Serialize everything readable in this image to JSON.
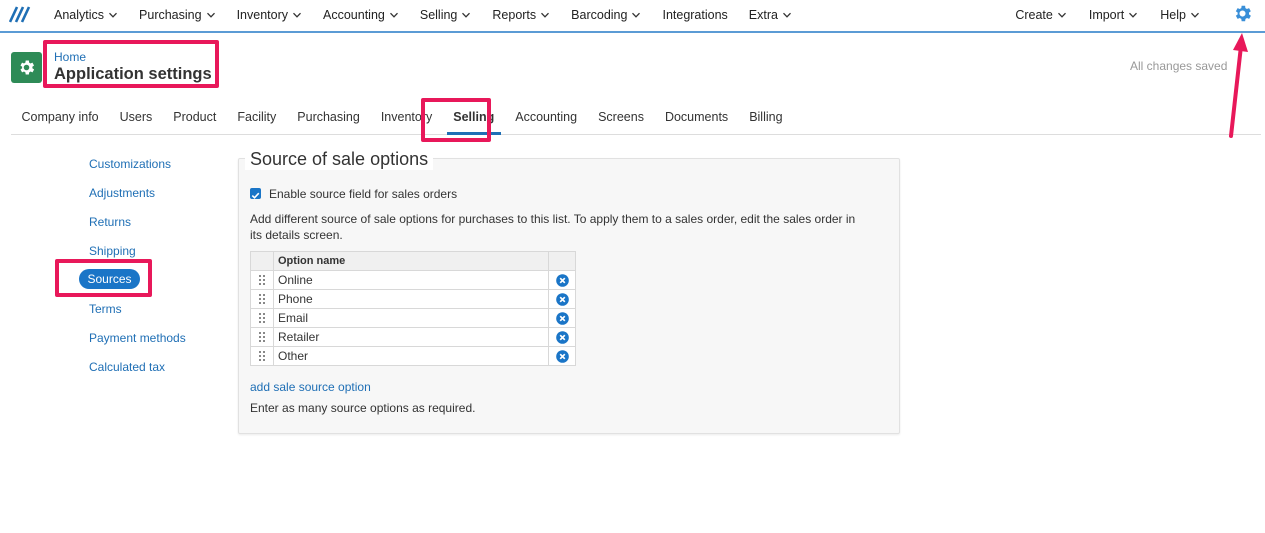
{
  "nav": {
    "items": [
      "Analytics",
      "Purchasing",
      "Inventory",
      "Accounting",
      "Selling",
      "Reports",
      "Barcoding",
      "Integrations",
      "Extra"
    ],
    "right_items": [
      "Create",
      "Import",
      "Help"
    ]
  },
  "header": {
    "breadcrumb": "Home",
    "title": "Application settings",
    "status": "All changes saved"
  },
  "tabs": [
    "Company info",
    "Users",
    "Product",
    "Facility",
    "Purchasing",
    "Inventory",
    "Selling",
    "Accounting",
    "Screens",
    "Documents",
    "Billing"
  ],
  "active_tab": "Selling",
  "sidebar": {
    "items": [
      "Customizations",
      "Adjustments",
      "Returns",
      "Shipping",
      "Sources",
      "Terms",
      "Payment methods",
      "Calculated tax"
    ],
    "active": "Sources"
  },
  "panel": {
    "title": "Source of sale options",
    "checkbox_label": "Enable source field for sales orders",
    "checkbox_checked": true,
    "description": "Add different source of sale options for purchases to this list. To apply them to a sales order, edit the sales order in its details screen.",
    "column_header": "Option name",
    "options": [
      "Online",
      "Phone",
      "Email",
      "Retailer",
      "Other"
    ],
    "add_link": "add sale source option",
    "hint": "Enter as many source options as required."
  },
  "colors": {
    "accent": "#1a75c7",
    "highlight": "#e8185a",
    "app_icon": "#2e8b57"
  }
}
